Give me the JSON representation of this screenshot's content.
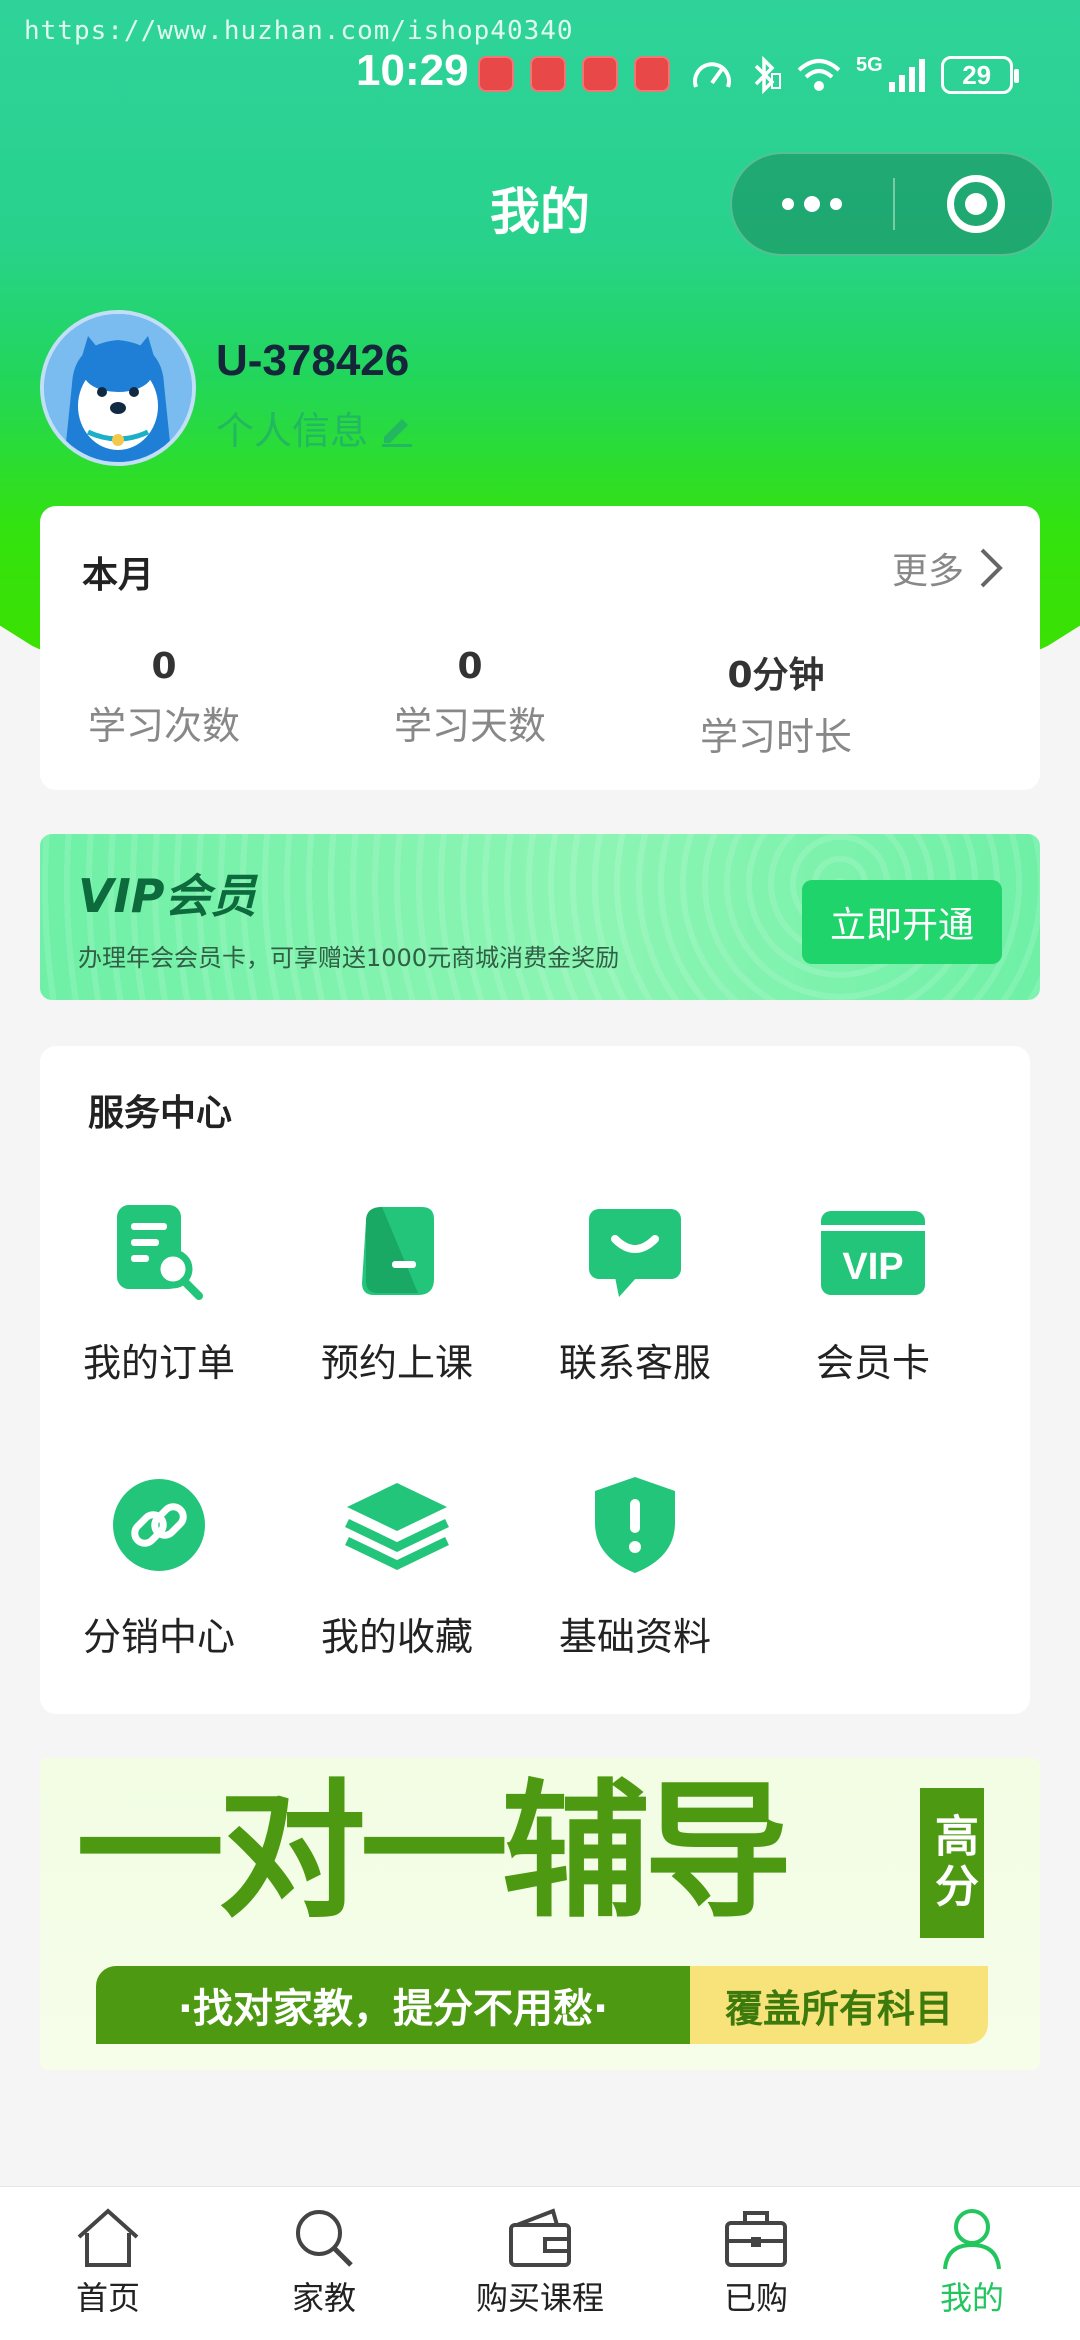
{
  "watermark": "https://www.huzhan.com/ishop40340",
  "status_bar": {
    "time": "10:29",
    "network": "5G",
    "battery": "29",
    "notification_icons": [
      "huawei-app-icon",
      "huawei-app-icon",
      "huawei-app-icon",
      "huawei-app-icon"
    ]
  },
  "nav": {
    "title": "我的"
  },
  "profile": {
    "username": "U-378426",
    "info_label": "个人信息"
  },
  "month": {
    "title": "本月",
    "more_label": "更多",
    "stats": [
      {
        "value": "0",
        "label": "学习次数"
      },
      {
        "value": "0",
        "label": "学习天数"
      },
      {
        "value": "0分钟",
        "label": "学习时长"
      }
    ]
  },
  "vip": {
    "title": "VIP会员",
    "subtitle": "办理年会会员卡，可享赠送1000元商城消费金奖励",
    "button": "立即开通"
  },
  "services": {
    "title": "服务中心",
    "items": [
      {
        "label": "我的订单",
        "icon": "order-search-icon"
      },
      {
        "label": "预约上课",
        "icon": "book-icon"
      },
      {
        "label": "联系客服",
        "icon": "chat-bubble-icon"
      },
      {
        "label": "会员卡",
        "icon": "vip-card-icon"
      },
      {
        "label": "分销中心",
        "icon": "link-icon"
      },
      {
        "label": "我的收藏",
        "icon": "layers-icon"
      },
      {
        "label": "基础资料",
        "icon": "shield-icon"
      }
    ]
  },
  "banner": {
    "headline": "一对一辅导",
    "tag": "高分",
    "slogan": "·找对家教，提分不用愁·",
    "coverage": "覆盖所有科目"
  },
  "tabbar": {
    "active_color": "#22c55e",
    "items": [
      {
        "label": "首页",
        "icon": "home-icon"
      },
      {
        "label": "家教",
        "icon": "search-icon"
      },
      {
        "label": "购买课程",
        "icon": "wallet-icon"
      },
      {
        "label": "已购",
        "icon": "briefcase-icon"
      },
      {
        "label": "我的",
        "icon": "user-icon"
      }
    ]
  },
  "colors": {
    "brand_green": "#22c55e",
    "header_gradient_top": "#2fd39a",
    "header_gradient_bottom": "#3ee000",
    "vip_button": "#1fd46b",
    "banner_green": "#4d9a12"
  }
}
